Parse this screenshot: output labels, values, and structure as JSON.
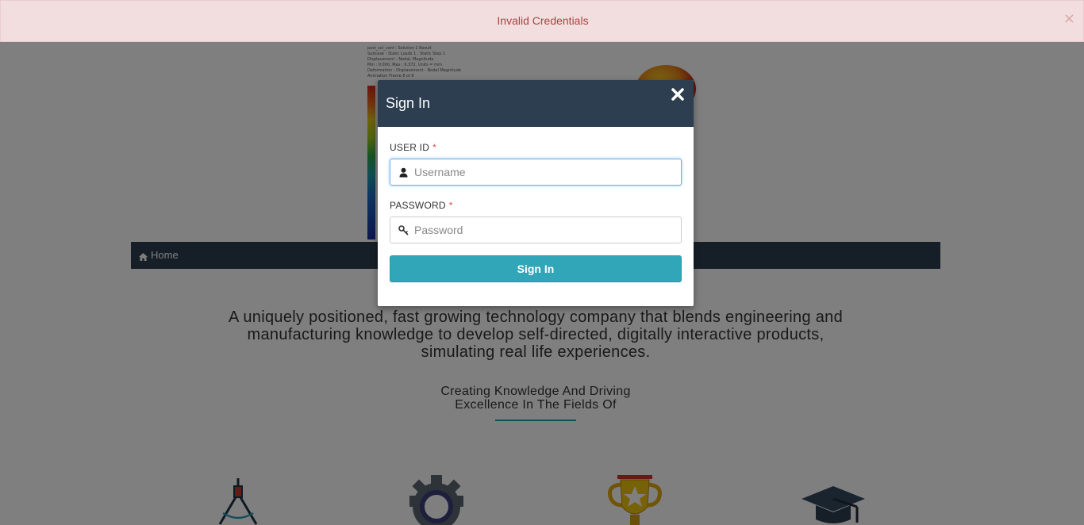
{
  "alert": {
    "message": "Invalid Credentials",
    "close_label": "×"
  },
  "navbar": {
    "home_label": "Home"
  },
  "main": {
    "tagline": "A uniquely positioned, fast growing technology company that blends engineering and manufacturing knowledge to develop self-directed, digitally interactive products, simulating real life experiences.",
    "subtag_line1": "Creating Knowledge And Driving",
    "subtag_line2": "Excellence In The Fields Of"
  },
  "hero": {
    "legend_lines": [
      "post_sol_conf : Solution 1 Result",
      "Subcase - Static Loads 1 : Static Step 1",
      "Displacement - Nodal, Magnitude",
      "Min : 0.000, Max : 0.372, Units = mm",
      "Deformation : Displacement - Nodal Magnitude",
      "Animation Frame 8 of 8"
    ]
  },
  "modal": {
    "title": "Sign In",
    "user_label": "USER ID",
    "password_label": "PASSWORD",
    "required_mark": "*",
    "username_placeholder": "Username",
    "password_placeholder": "Password",
    "submit_label": "Sign In"
  },
  "icons": {
    "alert_close": "close-icon",
    "modal_close": "close-circle-icon",
    "home": "home-icon",
    "user": "user-icon",
    "key": "key-icon",
    "features": [
      "compass-icon",
      "gear-icon",
      "trophy-icon",
      "graduation-cap-icon"
    ]
  },
  "colors": {
    "header_dark": "#2c3e50",
    "button_teal": "#31a6b8",
    "alert_bg": "#f2dede",
    "alert_text": "#a94442",
    "required": "#d9534f"
  }
}
